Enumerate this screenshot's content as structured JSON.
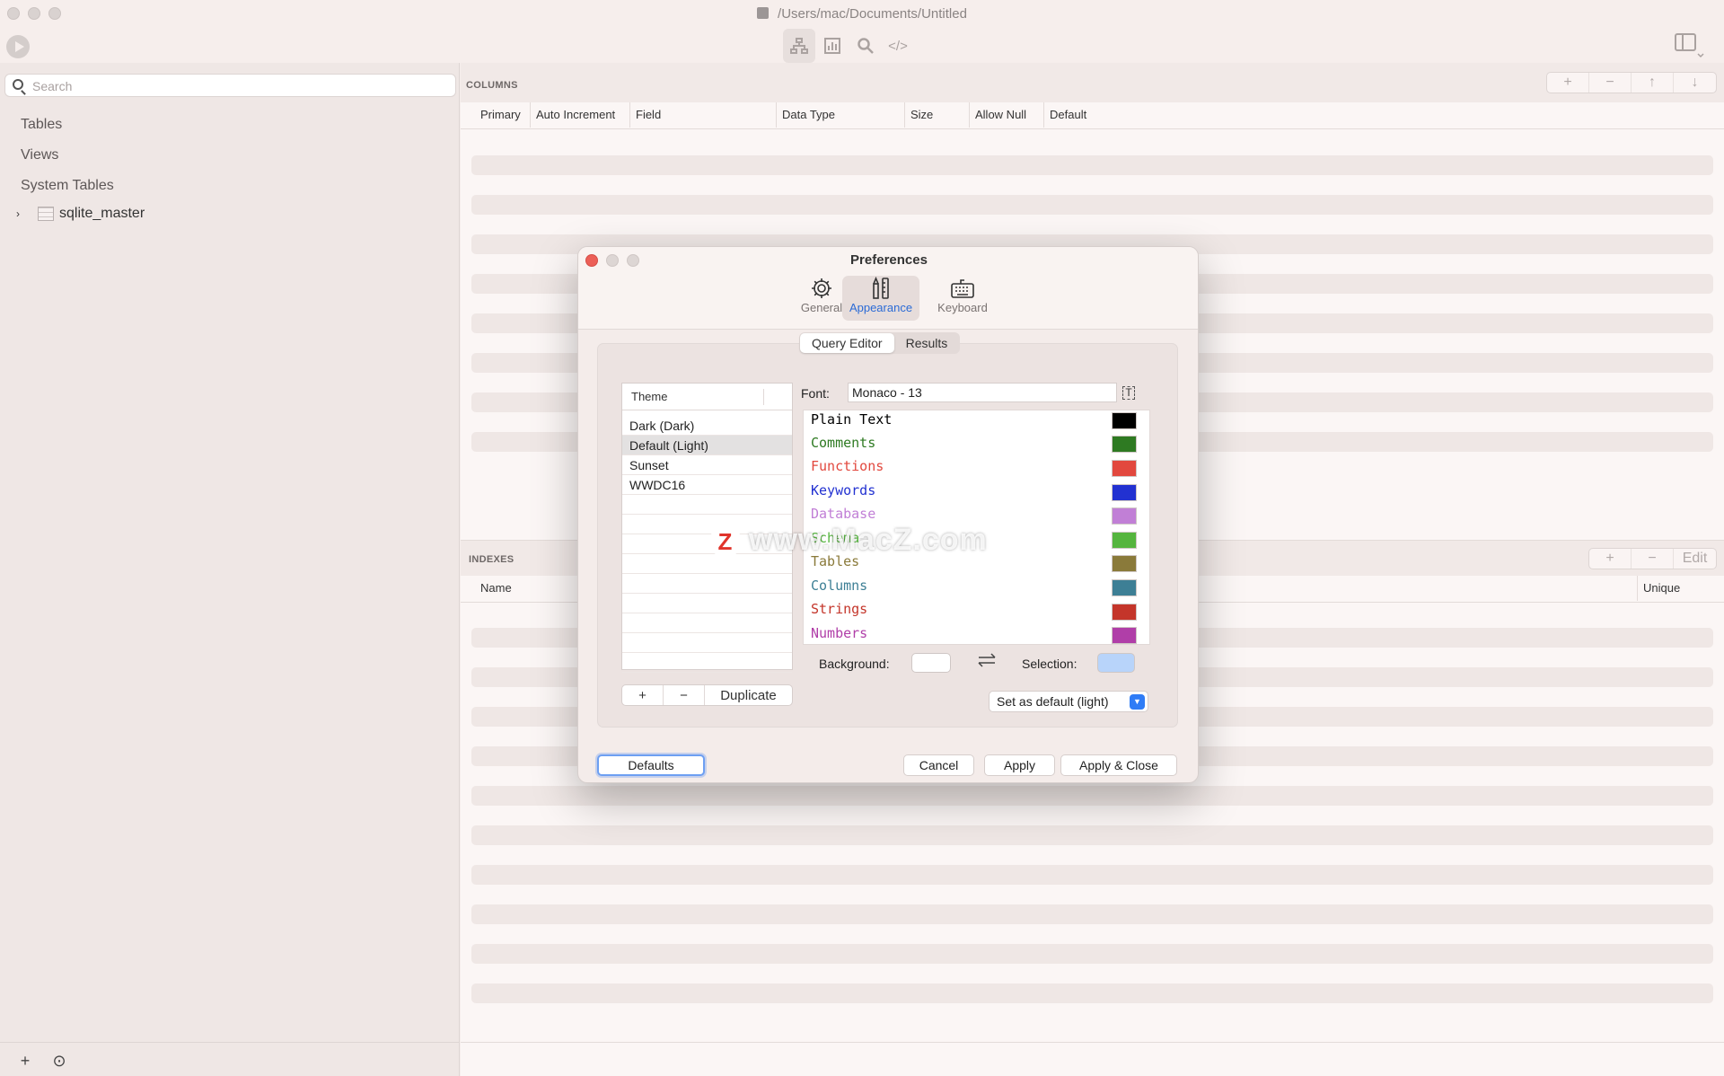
{
  "window": {
    "title": "/Users/mac/Documents/Untitled"
  },
  "toolbar": {
    "icons": [
      "play-icon",
      "structure-icon",
      "chart-icon",
      "search-icon",
      "code-icon",
      "panel-toggle-icon"
    ],
    "code_label": "</>"
  },
  "sidebar": {
    "search_placeholder": "Search",
    "items": [
      "Tables",
      "Views",
      "System Tables"
    ],
    "tree_item": "sqlite_master",
    "add_label": "+",
    "more_label": "⊙"
  },
  "columns": {
    "section_label": "COLUMNS",
    "headers": [
      "Primary",
      "Auto Increment",
      "Field",
      "Data Type",
      "Size",
      "Allow Null",
      "Default"
    ],
    "buttons": [
      "+",
      "−",
      "↑",
      "↓"
    ]
  },
  "indexes": {
    "section_label": "INDEXES",
    "headers": [
      "Name",
      "Unique"
    ],
    "buttons": [
      "+",
      "−",
      "Edit"
    ]
  },
  "preferences": {
    "title": "Preferences",
    "tabs": [
      "General",
      "Appearance",
      "Keyboard"
    ],
    "active_tab": "Appearance",
    "subtabs": [
      "Query Editor",
      "Results"
    ],
    "active_subtab": "Query Editor",
    "theme_header": "Theme",
    "themes": [
      "Dark (Dark)",
      "Default (Light)",
      "Sunset",
      "WWDC16"
    ],
    "selected_theme": "Default (Light)",
    "theme_buttons": {
      "add": "+",
      "remove": "−",
      "duplicate": "Duplicate"
    },
    "font_label": "Font:",
    "font_value": "Monaco - 13",
    "syntax": [
      {
        "label": "Plain Text",
        "color": "#000000"
      },
      {
        "label": "Comments",
        "color": "#2e7a22"
      },
      {
        "label": "Functions",
        "color": "#e2483e"
      },
      {
        "label": "Keywords",
        "color": "#2231d1"
      },
      {
        "label": "Database",
        "color": "#c17fd6"
      },
      {
        "label": "Schema",
        "color": "#55b53e"
      },
      {
        "label": "Tables",
        "color": "#8a7a3a"
      },
      {
        "label": "Columns",
        "color": "#3d7f95"
      },
      {
        "label": "Strings",
        "color": "#c4352a"
      },
      {
        "label": "Numbers",
        "color": "#b03ea8"
      }
    ],
    "background_label": "Background:",
    "background_color": "#ffffff",
    "selection_label": "Selection:",
    "selection_color": "#b8d4fa",
    "set_default": "Set as default (light)",
    "buttons": {
      "defaults": "Defaults",
      "cancel": "Cancel",
      "apply": "Apply",
      "apply_close": "Apply & Close"
    }
  },
  "watermark": {
    "text": "www.MacZ.com",
    "logo_letter": "Z"
  }
}
